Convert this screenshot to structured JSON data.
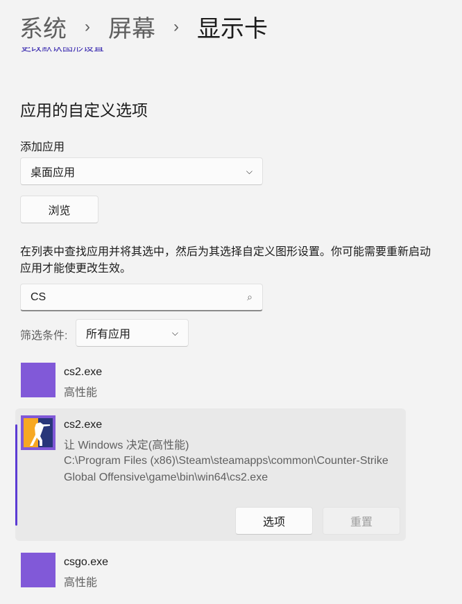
{
  "breadcrumb": {
    "items": [
      "系统",
      "屏幕",
      "显示卡"
    ]
  },
  "link": "更改默认图形设置",
  "section_title": "应用的自定义选项",
  "add_app": {
    "label": "添加应用",
    "selected": "桌面应用",
    "browse": "浏览"
  },
  "description": "在列表中查找应用并将其选中，然后为其选择自定义图形设置。你可能需要重新启动应用才能使更改生效。",
  "search": {
    "value": "CS"
  },
  "filter": {
    "label": "筛选条件:",
    "selected": "所有应用"
  },
  "apps": [
    {
      "name": "cs2.exe",
      "setting": "高性能"
    },
    {
      "name": "cs2.exe",
      "setting": "让 Windows 决定(高性能)",
      "path": "C:\\Program Files (x86)\\Steam\\steamapps\\common\\Counter-Strike Global Offensive\\game\\bin\\win64\\cs2.exe",
      "options": "选项",
      "reset": "重置"
    },
    {
      "name": "csgo.exe",
      "setting": "高性能"
    }
  ],
  "colors": {
    "accent": "#5b3bd3",
    "app_icon": "#8159d8"
  }
}
